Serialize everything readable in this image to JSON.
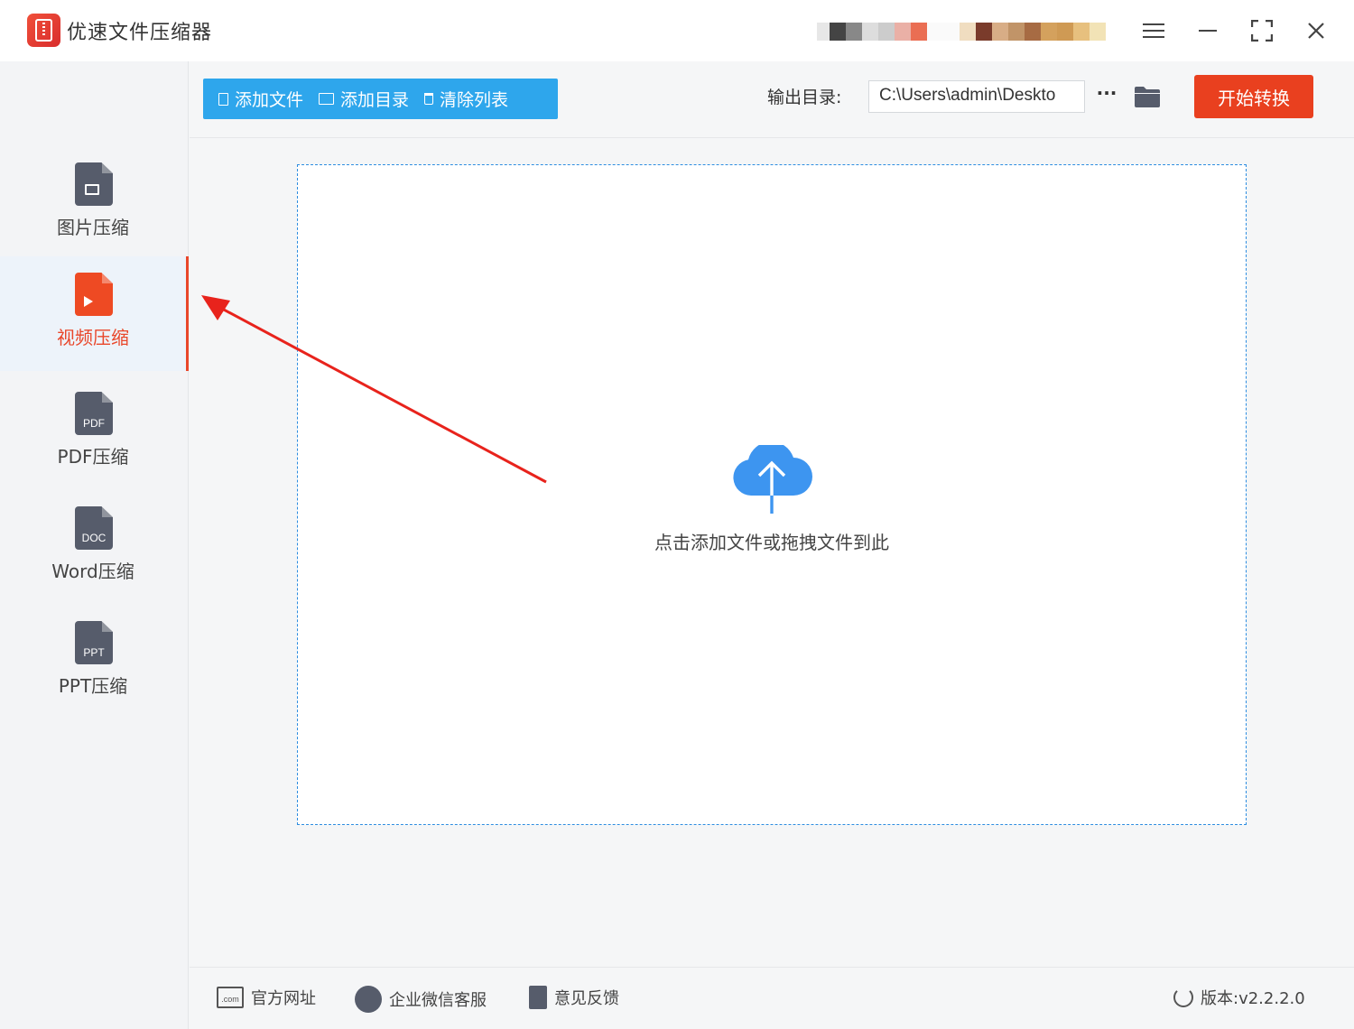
{
  "app": {
    "title": "优速文件压缩器"
  },
  "window_controls": [
    "menu-icon",
    "minimize-icon",
    "maximize-icon",
    "close-icon"
  ],
  "sidebar": {
    "items": [
      {
        "label": "图片压缩",
        "icon": "image-file-icon",
        "active": false
      },
      {
        "label": "视频压缩",
        "icon": "video-file-icon",
        "active": true
      },
      {
        "label": "PDF压缩",
        "icon": "pdf-file-icon",
        "icon_text": "PDF",
        "active": false
      },
      {
        "label": "Word压缩",
        "icon": "doc-file-icon",
        "icon_text": "DOC",
        "active": false
      },
      {
        "label": "PPT压缩",
        "icon": "ppt-file-icon",
        "icon_text": "PPT",
        "active": false
      }
    ]
  },
  "toolbar": {
    "add_file": "添加文件",
    "add_dir": "添加目录",
    "clear_list": "清除列表",
    "output_label": "输出目录:",
    "output_path": "C:\\Users\\admin\\Deskto",
    "more": "···",
    "start": "开始转换"
  },
  "dropzone": {
    "text": "点击添加文件或拖拽文件到此"
  },
  "footer": {
    "website": "官方网址",
    "website_icon_text": ".com",
    "wechat": "企业微信客服",
    "feedback": "意见反馈",
    "version": "版本:v2.2.2.0"
  },
  "colors": {
    "accent_blue": "#2ea6ec",
    "start_red": "#e9401f",
    "active_red": "#e9472b",
    "icon_gray": "#565c6b",
    "cloud_blue": "#3d95f0"
  }
}
